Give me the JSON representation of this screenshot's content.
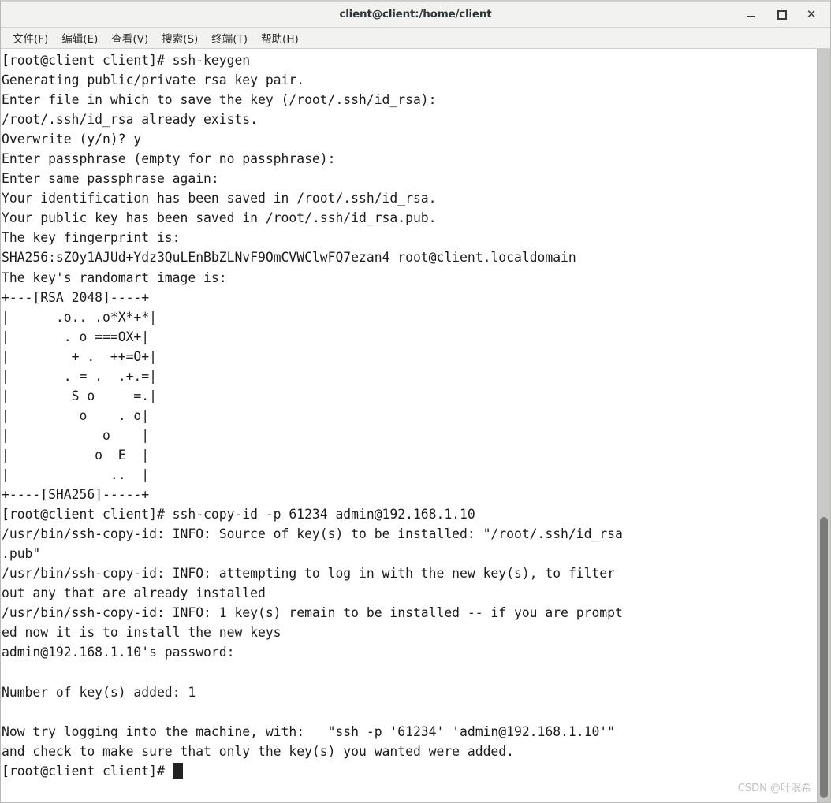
{
  "window": {
    "title": "client@client:/home/client",
    "controls": [
      {
        "name": "minimize-button",
        "glyph": ""
      },
      {
        "name": "maximize-button",
        "glyph": ""
      },
      {
        "name": "close-button",
        "glyph": "✕"
      }
    ]
  },
  "menubar": {
    "items": [
      {
        "label": "文件(F)",
        "name": "menu-file"
      },
      {
        "label": "编辑(E)",
        "name": "menu-edit"
      },
      {
        "label": "查看(V)",
        "name": "menu-view"
      },
      {
        "label": "搜索(S)",
        "name": "menu-search"
      },
      {
        "label": "终端(T)",
        "name": "menu-terminal"
      },
      {
        "label": "帮助(H)",
        "name": "menu-help"
      }
    ]
  },
  "terminal": {
    "prompt": "[root@client client]# ",
    "commands": [
      "ssh-keygen",
      "ssh-copy-id -p 61234 admin@192.168.1.10"
    ],
    "fingerprint": "SHA256:sZOy1AJUd+Ydz3QuLEnBbZLNvF9OmCVWClwFQ7ezan4 root@client.localdomain",
    "key_type": "RSA 2048",
    "hash_type": "SHA256",
    "keys_added": "1",
    "port": "61234",
    "remote_user_host": "admin@192.168.1.10",
    "key_path": "/root/.ssh/id_rsa",
    "pub_key_path": "/root/.ssh/id_rsa.pub",
    "randomart": [
      "+---[RSA 2048]----+",
      "|      .o.. .o*X*+*|",
      "|       . o ===OX+|",
      "|        + .  ++=O+|",
      "|       . = .  .+.=|",
      "|        S o     =.|",
      "|         o    . o|",
      "|            o    |",
      "|           o  E  |",
      "|             ..  |",
      "+----[SHA256]-----+"
    ],
    "text": "[root@client client]# ssh-keygen\nGenerating public/private rsa key pair.\nEnter file in which to save the key (/root/.ssh/id_rsa): \n/root/.ssh/id_rsa already exists.\nOverwrite (y/n)? y\nEnter passphrase (empty for no passphrase): \nEnter same passphrase again: \nYour identification has been saved in /root/.ssh/id_rsa.\nYour public key has been saved in /root/.ssh/id_rsa.pub.\nThe key fingerprint is:\nSHA256:sZOy1AJUd+Ydz3QuLEnBbZLNvF9OmCVWClwFQ7ezan4 root@client.localdomain\nThe key's randomart image is:\n+---[RSA 2048]----+\n|      .o.. .o*X*+*|\n|       . o ===OX+|\n|        + .  ++=O+|\n|       . = .  .+.=|\n|        S o     =.|\n|         o    . o|\n|            o    |\n|           o  E  |\n|             ..  |\n+----[SHA256]-----+\n[root@client client]# ssh-copy-id -p 61234 admin@192.168.1.10\n/usr/bin/ssh-copy-id: INFO: Source of key(s) to be installed: \"/root/.ssh/id_rsa\n.pub\"\n/usr/bin/ssh-copy-id: INFO: attempting to log in with the new key(s), to filter\nout any that are already installed\n/usr/bin/ssh-copy-id: INFO: 1 key(s) remain to be installed -- if you are prompt\ned now it is to install the new keys\nadmin@192.168.1.10's password: \n\nNumber of key(s) added: 1\n\nNow try logging into the machine, with:   \"ssh -p '61234' 'admin@192.168.1.10'\"\nand check to make sure that only the key(s) you wanted were added.\n",
    "final_prompt": "[root@client client]# "
  },
  "scrollbar": {
    "thumb_top_px": "594",
    "thumb_height_px": "357"
  },
  "watermark": {
    "text": "CSDN @叶泯希"
  }
}
